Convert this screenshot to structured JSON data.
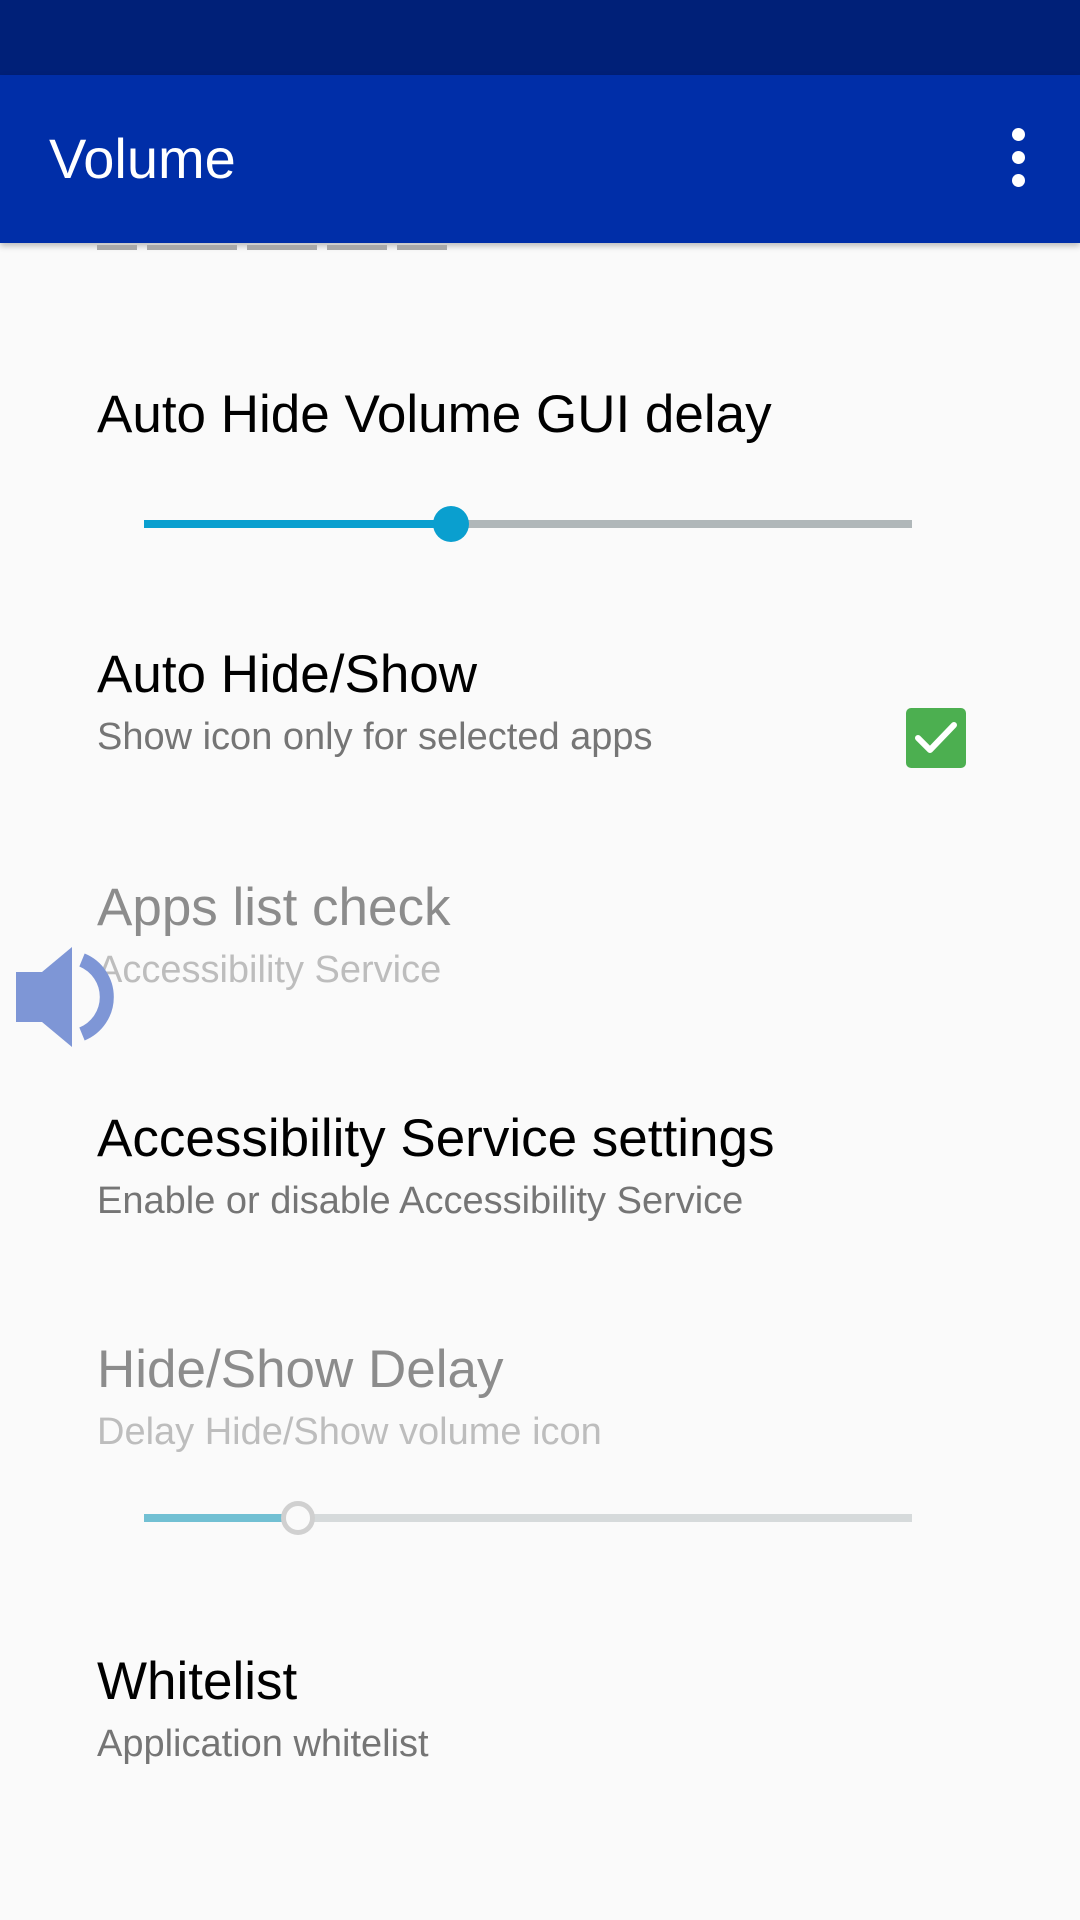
{
  "app_bar": {
    "title": "Volume",
    "overflow_icon": "more-vert-icon"
  },
  "preferences": {
    "auto_hide_delay": {
      "title": "Auto Hide Volume GUI delay",
      "slider_value": 0.4
    },
    "auto_hide_show": {
      "title": "Auto Hide/Show",
      "summary": "Show icon only for selected apps",
      "checked": true
    },
    "apps_list_check": {
      "title": "Apps list check",
      "summary": "Accessibility Service",
      "enabled": false
    },
    "accessibility_settings": {
      "title": "Accessibility Service settings",
      "summary": "Enable or disable Accessibility Service"
    },
    "hide_show_delay": {
      "title": "Hide/Show Delay",
      "summary": "Delay Hide/Show volume icon",
      "slider_value": 0.2,
      "enabled": false
    },
    "whitelist": {
      "title": "Whitelist",
      "summary": "Application whitelist"
    }
  },
  "floating_widget": {
    "icon": "volume-speaker-icon",
    "color": "#7e96d6"
  },
  "colors": {
    "status_bar": "#002078",
    "app_bar": "#002ea8",
    "accent": "#0a9fcf",
    "checkbox": "#4caf50"
  }
}
